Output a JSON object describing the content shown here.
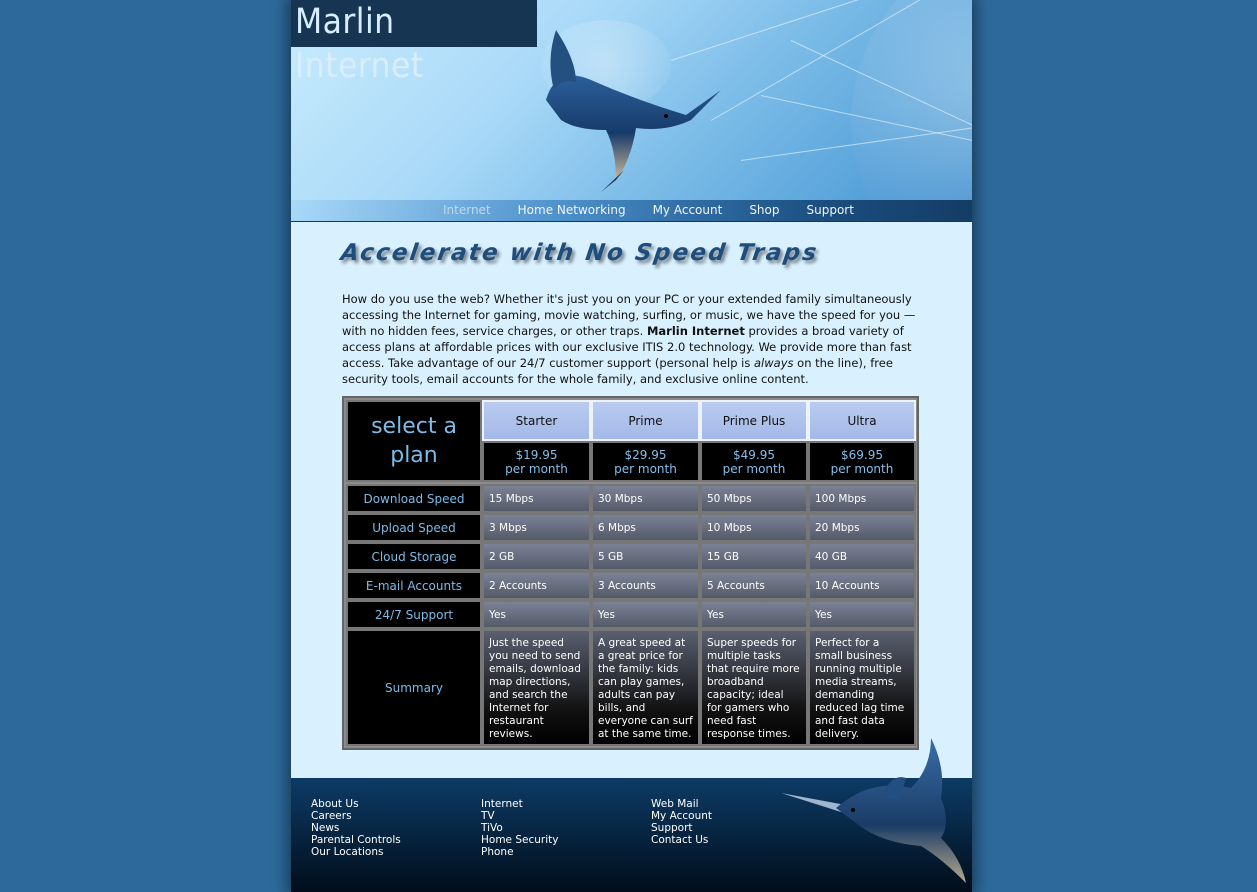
{
  "header": {
    "logo": "Marlin Internet",
    "nav": [
      "Internet",
      "Home Networking",
      "My Account",
      "Shop",
      "Support"
    ]
  },
  "main": {
    "headline": "Accelerate with No Speed Traps",
    "intro": {
      "part1": "How do you use the web? Whether it's just you on your PC or your extended family simultaneously accessing the Internet for gaming, movie watching, surfing, or music, we have the speed for you — with no hidden fees, service charges, or other traps. ",
      "brand": "Marlin Internet",
      "part2": " provides a broad variety of access plans at affordable prices with our exclusive ITIS 2.0 technology. We provide more than fast access. Take advantage of our 24/7 customer support (personal help is ",
      "emph": "always",
      "part3": " on the line), free security tools, email accounts for the whole family, and exclusive online content."
    }
  },
  "plans": {
    "corner_label": "select a plan",
    "names": [
      "Starter",
      "Prime",
      "Prime Plus",
      "Ultra"
    ],
    "prices": [
      "$19.95",
      "$29.95",
      "$49.95",
      "$69.95"
    ],
    "price_period": "per month",
    "row_labels": [
      "Download Speed",
      "Upload Speed",
      "Cloud Storage",
      "E-mail Accounts",
      "24/7 Support",
      "Summary"
    ],
    "rows": [
      [
        "15 Mbps",
        "30 Mbps",
        "50 Mbps",
        "100 Mbps"
      ],
      [
        "3 Mbps",
        "6 Mbps",
        "10 Mbps",
        "20 Mbps"
      ],
      [
        "2 GB",
        "5 GB",
        "15 GB",
        "40 GB"
      ],
      [
        "2 Accounts",
        "3 Accounts",
        "5 Accounts",
        "10 Accounts"
      ],
      [
        "Yes",
        "Yes",
        "Yes",
        "Yes"
      ]
    ],
    "summaries": [
      "Just the speed you need to send emails, download map directions, and search the Internet for restaurant reviews.",
      "A great speed at a great price for the family: kids can play games, adults can pay bills, and everyone can surf at the same time.",
      "Super speeds for multiple tasks that require more broadband capacity; ideal for gamers who need fast response times.",
      "Perfect for a small business running multiple media streams, demanding reduced lag time and fast data delivery."
    ]
  },
  "footer": {
    "col1": [
      "About Us",
      "Careers",
      "News",
      "Parental Controls",
      "Our Locations"
    ],
    "col2": [
      "Internet",
      "TV",
      "TiVo",
      "Home Security",
      "Phone"
    ],
    "col3": [
      "Web Mail",
      "My Account",
      "Support",
      "Contact Us"
    ]
  }
}
